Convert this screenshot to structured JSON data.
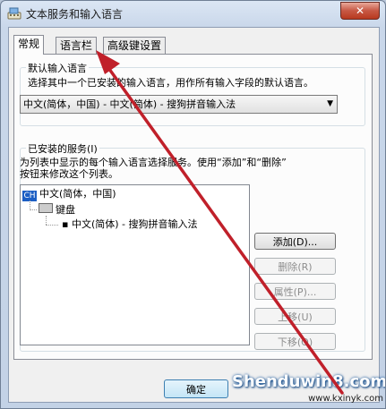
{
  "window": {
    "title": "文本服务和输入语言",
    "close_label": "✕"
  },
  "tabs": [
    {
      "label": "常规",
      "active": true
    },
    {
      "label": "语言栏",
      "active": false
    },
    {
      "label": "高级键设置",
      "active": false
    }
  ],
  "default_language": {
    "group_title": "默认输入语言",
    "description": "选择其中一个已安装的输入语言，用作所有输入字段的默认语言。",
    "selected": "中文(简体，中国) - 中文(简体) - 搜狗拼音输入法"
  },
  "installed_services": {
    "group_title": "已安装的服务(I)",
    "description_line1": "为列表中显示的每个输入语言选择服务。使用“添加”和“删除”",
    "description_line2": "按钮来修改这个列表。",
    "tree": {
      "language_badge": "CH",
      "language": "中文(简体，中国)",
      "category": "键盘",
      "service": "中文(简体) - 搜狗拼音输入法"
    },
    "buttons": {
      "add": "添加(D)...",
      "remove": "删除(R)",
      "properties": "属性(P)...",
      "move_up": "上移(U)",
      "move_down": "下移(O)"
    }
  },
  "footer": {
    "ok_label": "确定"
  },
  "watermark": {
    "text": "Shenduwin8.com",
    "url": "www.kxinyk.com"
  },
  "colors": {
    "annotation_arrow": "#c0202a",
    "ok_border": "#3c7fb1",
    "language_badge": "#1d5fc4"
  }
}
